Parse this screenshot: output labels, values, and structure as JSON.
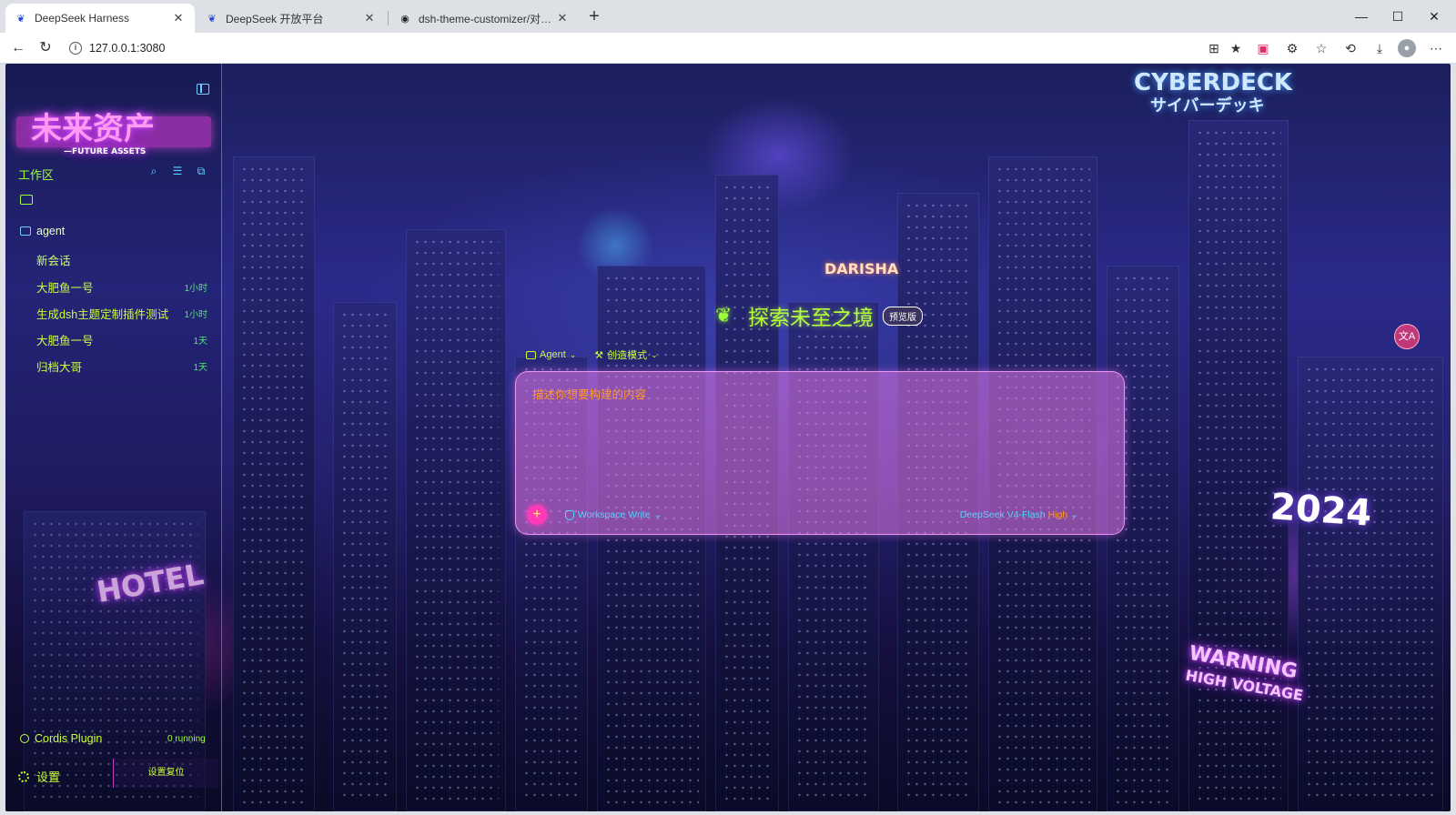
{
  "browser": {
    "tabs": [
      {
        "title": "DeepSeek Harness",
        "active": true,
        "icon": "deepseek-whale-icon"
      },
      {
        "title": "DeepSeek 开放平台",
        "active": false,
        "icon": "deepseek-whale-icon"
      },
      {
        "title": "dsh-theme-customizer/对话区测试",
        "active": false,
        "icon": "github-icon"
      }
    ],
    "url": "127.0.0.1:3080"
  },
  "background": {
    "neon_signs": [
      "未来资产",
      "—FUTURE ASSETS",
      "CYBERDECK",
      "サイバーデッキ",
      "HOTEL",
      "2024",
      "WARNING",
      "HIGH VOLTAGE",
      "DARISHA"
    ]
  },
  "sidebar": {
    "workspace_label": "工作区",
    "agent_folder": "agent",
    "new_chat": "新会话",
    "conversations": [
      {
        "title": "大肥鱼一号",
        "time": "1小时"
      },
      {
        "title": "生成dsh主题定制插件测试",
        "time": "1小时"
      },
      {
        "title": "大肥鱼一号",
        "time": "1天"
      },
      {
        "title": "归档大哥",
        "time": "1天"
      }
    ],
    "plugin_name": "Cordis Plugin",
    "plugin_status": "0 running",
    "settings_label": "设置",
    "reset_label": "设置复位"
  },
  "main": {
    "title": "探索未至之境",
    "badge": "预览版",
    "mode_agent": "Agent",
    "mode_create": "创造模式",
    "placeholder": "描述你想要构建的内容",
    "permission": "Workspace Write",
    "model_name": "DeepSeek V4-Flash",
    "model_effort": "High"
  },
  "colors": {
    "accent_green": "#b5ff3a",
    "accent_cyan": "#4fd8ff",
    "accent_pink": "#ff3ab8",
    "accent_orange": "#ff9a2a"
  }
}
